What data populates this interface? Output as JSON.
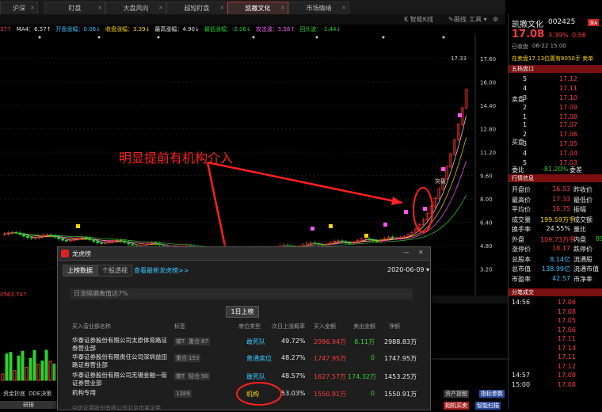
{
  "tabs": [
    {
      "label": "沪深",
      "active": false
    },
    {
      "label": "盯盘",
      "active": false
    },
    {
      "label": "大盘风向",
      "active": false
    },
    {
      "label": "超短盯盘",
      "active": false
    },
    {
      "label": "凯撒文化",
      "active": true
    },
    {
      "label": "市场情绪",
      "active": false
    }
  ],
  "toolbar": {
    "smart_kline": "智能K线",
    "draw": "画线",
    "tools": "工具"
  },
  "indicators": [
    {
      "text": "37↑",
      "color": "#ff3b3b"
    },
    {
      "text": "MA4：6.57↑",
      "color": "#e6e6e6"
    },
    {
      "text": "开盘涨幅：0.06↓",
      "color": "#39c6ff"
    },
    {
      "text": "收盘涨幅：3.39↓",
      "color": "#ffd700"
    },
    {
      "text": "最高涨幅：4.90↓",
      "color": "#e6e6e6"
    },
    {
      "text": "最低涨幅：-2.06↓",
      "color": "#2fd12f"
    },
    {
      "text": "攻击波：5.56↑",
      "color": "#ff55ff"
    },
    {
      "text": "回头波：-1.44↓",
      "color": "#2fd12f"
    }
  ],
  "chart": {
    "y_ticks": [
      "17.60",
      "16.00",
      "14.40",
      "12.80",
      "11.20",
      "9.60",
      "8.00",
      "6.40",
      "4.80",
      "3.20"
    ],
    "peak_label": "17.33",
    "tag_label": "突破",
    "annotation": "明显提前有机构介入",
    "lower_value": "0563.74↑",
    "bottom_buttons": [
      "资金抄底",
      "DDE决策"
    ],
    "bottom_tab": "研报",
    "bottom_right_btns": [
      "资产提醒",
      "指标参数"
    ],
    "bottom_right_btns2": [
      "相机买卖",
      "智能扫描"
    ]
  },
  "stock": {
    "name": "凯撒文化",
    "code": "002425",
    "badge": "深A",
    "price": "17.08",
    "pct": "3.39%",
    "chg": "0.56",
    "status": "已收盘",
    "time": "06-22 15:00",
    "info": "在卖盘17.13位置有8050手 卖单"
  },
  "order_book": {
    "title": "五档盘口",
    "sell_label": "卖盘",
    "buy_label": "买盘",
    "sells": [
      {
        "lvl": "5",
        "price": "17.12"
      },
      {
        "lvl": "4",
        "price": "17.11"
      },
      {
        "lvl": "3",
        "price": "17.10"
      },
      {
        "lvl": "2",
        "price": "17.09"
      },
      {
        "lvl": "1",
        "price": "17.08"
      }
    ],
    "buys": [
      {
        "lvl": "1",
        "price": "17.07"
      },
      {
        "lvl": "2",
        "price": "17.06"
      },
      {
        "lvl": "3",
        "price": "17.05"
      },
      {
        "lvl": "4",
        "price": "17.04"
      },
      {
        "lvl": "5",
        "price": "17.03"
      }
    ],
    "weibi_label": "委比",
    "weibi_value": "-81.20%",
    "weicha_label": "委差"
  },
  "quote": {
    "title": "行情信息",
    "open_label": "开盘价",
    "open": "16.53",
    "prev_label": "昨收价",
    "high_label": "最高价",
    "high": "17.33",
    "low_label": "最低价",
    "avg_label": "平均价",
    "avg": "16.75",
    "amp_label": "振幅",
    "vol_label": "成交量",
    "vol": "199.59万手",
    "amt_label": "成交额",
    "turn_label": "换手率",
    "turn": "24.55%",
    "ratio_label": "量比",
    "outer_label": "外盘",
    "outer": "109.73万手",
    "inner_label": "内盘",
    "inner_val": "89",
    "limit_label": "涨停价",
    "limit": "18.17",
    "drop_label": "跌停价",
    "total_share_label": "总股本",
    "total_share": "8.14亿",
    "float_label": "流通股",
    "mcap_label": "总市值",
    "mcap": "138.99亿",
    "float_cap_label": "流通市值",
    "pe_label": "市盈率",
    "pe": "42.57",
    "pb_label": "市净率"
  },
  "ticks": {
    "title": "分笔成交",
    "rows": [
      {
        "time": "14:56",
        "price": "17.06"
      },
      {
        "time": "",
        "price": "17.08"
      },
      {
        "time": "",
        "price": "17.05"
      },
      {
        "time": "",
        "price": "17.06"
      },
      {
        "time": "",
        "price": "17.11"
      },
      {
        "time": "",
        "price": "17.14"
      },
      {
        "time": "",
        "price": "17.11"
      },
      {
        "time": "",
        "price": "17.12"
      },
      {
        "time": "14:57",
        "price": "17.08"
      },
      {
        "time": "15:00",
        "price": "17.08"
      }
    ]
  },
  "dialog": {
    "title": "龙虎榜",
    "tab1": "上榜数据",
    "tab2": "个股透视",
    "link": "查看最新龙虎榜>>",
    "date": "2020-06-09",
    "reason": "日涨幅偏离值达7%",
    "day_btn": "1日上榜",
    "headers": [
      "买入营业部名称",
      "标签",
      "席位类型",
      "次日上涨概率",
      "买入金额",
      "卖出金额",
      "净额"
    ],
    "rows": [
      {
        "name": "华泰证券股份有限公司太原体育路证券营业部",
        "tags": [
          "做T",
          "重仓",
          "87"
        ],
        "type": "敢死队",
        "prob": "49.72%",
        "buy": "2996.94万",
        "sell": "8.11万",
        "net": "2988.83万"
      },
      {
        "name": "华泰证券股份有限责任公司深圳益田路证券营业部",
        "tags": [
          "重仓",
          "153"
        ],
        "type": "普通席位",
        "prob": "48.27%",
        "buy": "1747.95万",
        "sell": "0",
        "net": "1747.95万"
      },
      {
        "name": "华泰证券股份有限公司无锡金融一街证券营业部",
        "tags": [
          "做T",
          "轻仓",
          "90"
        ],
        "type": "敢死队",
        "prob": "48.57%",
        "buy": "1627.57万",
        "sell": "174.32万",
        "net": "1453.25万"
      },
      {
        "name": "机构专用",
        "tags": [
          "1389"
        ],
        "type": "机构",
        "prob": "53.03%",
        "buy": "1550.91万",
        "sell": "0",
        "net": "1550.91万"
      }
    ],
    "partial_row": "中信证券股份有限公司北京市某证券"
  }
}
